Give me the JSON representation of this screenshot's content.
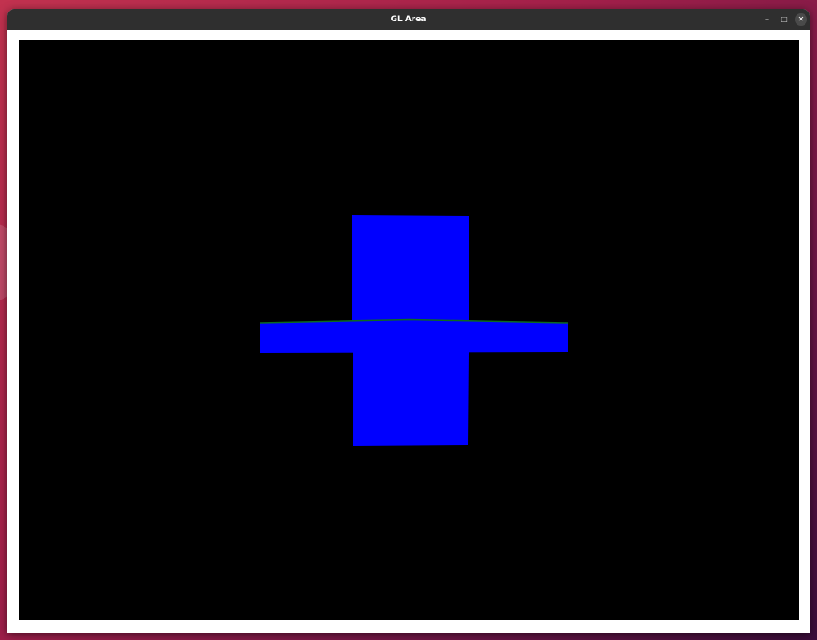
{
  "window": {
    "title": "GL Area"
  },
  "titlebar_buttons": {
    "minimize_glyph": "–",
    "maximize_glyph": "□",
    "close_glyph": "✕"
  },
  "icons": {
    "minimize": "minimize-icon",
    "maximize": "maximize-icon",
    "close": "close-icon"
  },
  "scene": {
    "background_color": "#000000",
    "fill_color": "#0000ff",
    "edge_color": "#0b6b1e"
  }
}
